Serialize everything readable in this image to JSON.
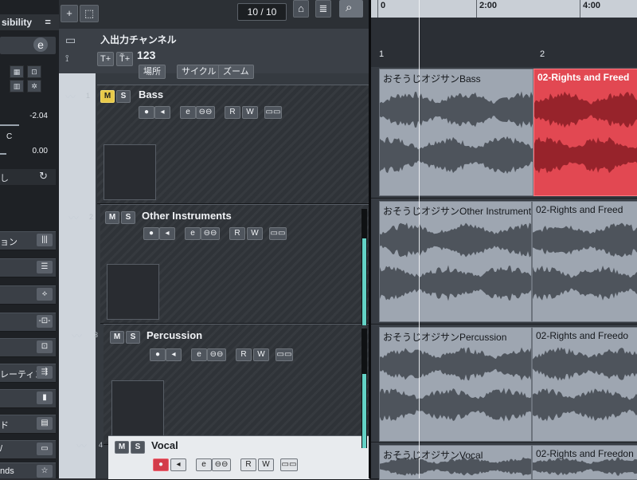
{
  "inspector": {
    "visibility_label": "sibility",
    "menu_glyph": "=",
    "edit_glyph": "e",
    "fader1_value": "-2.04",
    "fader_c_label": "C",
    "fader2_value": "0.00",
    "reset_label": "し",
    "sections": [
      {
        "label": "ョン",
        "icon": "|||"
      },
      {
        "label": "",
        "icon": "☰"
      },
      {
        "label": "",
        "icon": "⟡"
      },
      {
        "label": "",
        "icon": "-⊡-"
      },
      {
        "label": "",
        "icon": "⊡"
      },
      {
        "label": "レーティング",
        "icon": "⇶"
      },
      {
        "label": "",
        "icon": "▮"
      },
      {
        "label": "ド",
        "icon": "▤"
      },
      {
        "label": "/",
        "icon": "▭"
      },
      {
        "label": "nds",
        "icon": "☆"
      }
    ]
  },
  "toolbar": {
    "add_glyph": "+",
    "folder_glyph": "⬚",
    "counter": "10 / 10",
    "home_glyph": "⌂",
    "list_glyph": "≣",
    "search_glyph": "⌕"
  },
  "folder": {
    "title": "入出力チャンネル",
    "number": "123",
    "btn_t_plus": "T+",
    "btn_tt_plus": "T̃+",
    "chips": [
      "場所",
      "サイクル",
      "ズーム"
    ]
  },
  "tracks": [
    {
      "index": "1",
      "name": "Bass",
      "mute_on": true,
      "rec_on": false,
      "selected": false,
      "meter": 0.0
    },
    {
      "index": "2",
      "name": "Other Instruments",
      "mute_on": false,
      "rec_on": false,
      "selected": false,
      "meter": 0.75
    },
    {
      "index": "3",
      "name": "Percussion",
      "mute_on": false,
      "rec_on": false,
      "selected": false,
      "meter": 0.62
    },
    {
      "index": "4",
      "name": "Vocal",
      "mute_on": false,
      "rec_on": true,
      "selected": true,
      "meter": 0.0
    }
  ],
  "track_buttons": {
    "mute": "M",
    "solo": "S",
    "record": "●",
    "monitor": "◂",
    "edit": "e",
    "link": "⊖⊖",
    "read": "R",
    "write": "W",
    "lanes": "▭▭"
  },
  "ruler": {
    "labels": [
      "0",
      "2:00",
      "4:00"
    ]
  },
  "markers": {
    "m1": "1",
    "m2": "2"
  },
  "events": [
    {
      "lane": 0,
      "left_name": "おそうじオジサンBass",
      "right_name": "02-Rights and Freed",
      "right_red": true
    },
    {
      "lane": 1,
      "left_name": "おそうじオジサンOther Instruments",
      "right_name": "02-Rights and Freed",
      "right_red": false
    },
    {
      "lane": 2,
      "left_name": "おそうじオジサンPercussion",
      "right_name": "02-Rights and Freedo",
      "right_red": false
    },
    {
      "lane": 3,
      "left_name": "おそうじオジサンVocal",
      "right_name": "02-Rights and Freedon",
      "right_red": false
    }
  ],
  "colors": {
    "accent_red": "#e24852",
    "meter_cyan": "#63d2c6",
    "mute_yellow": "#e8c94a"
  }
}
